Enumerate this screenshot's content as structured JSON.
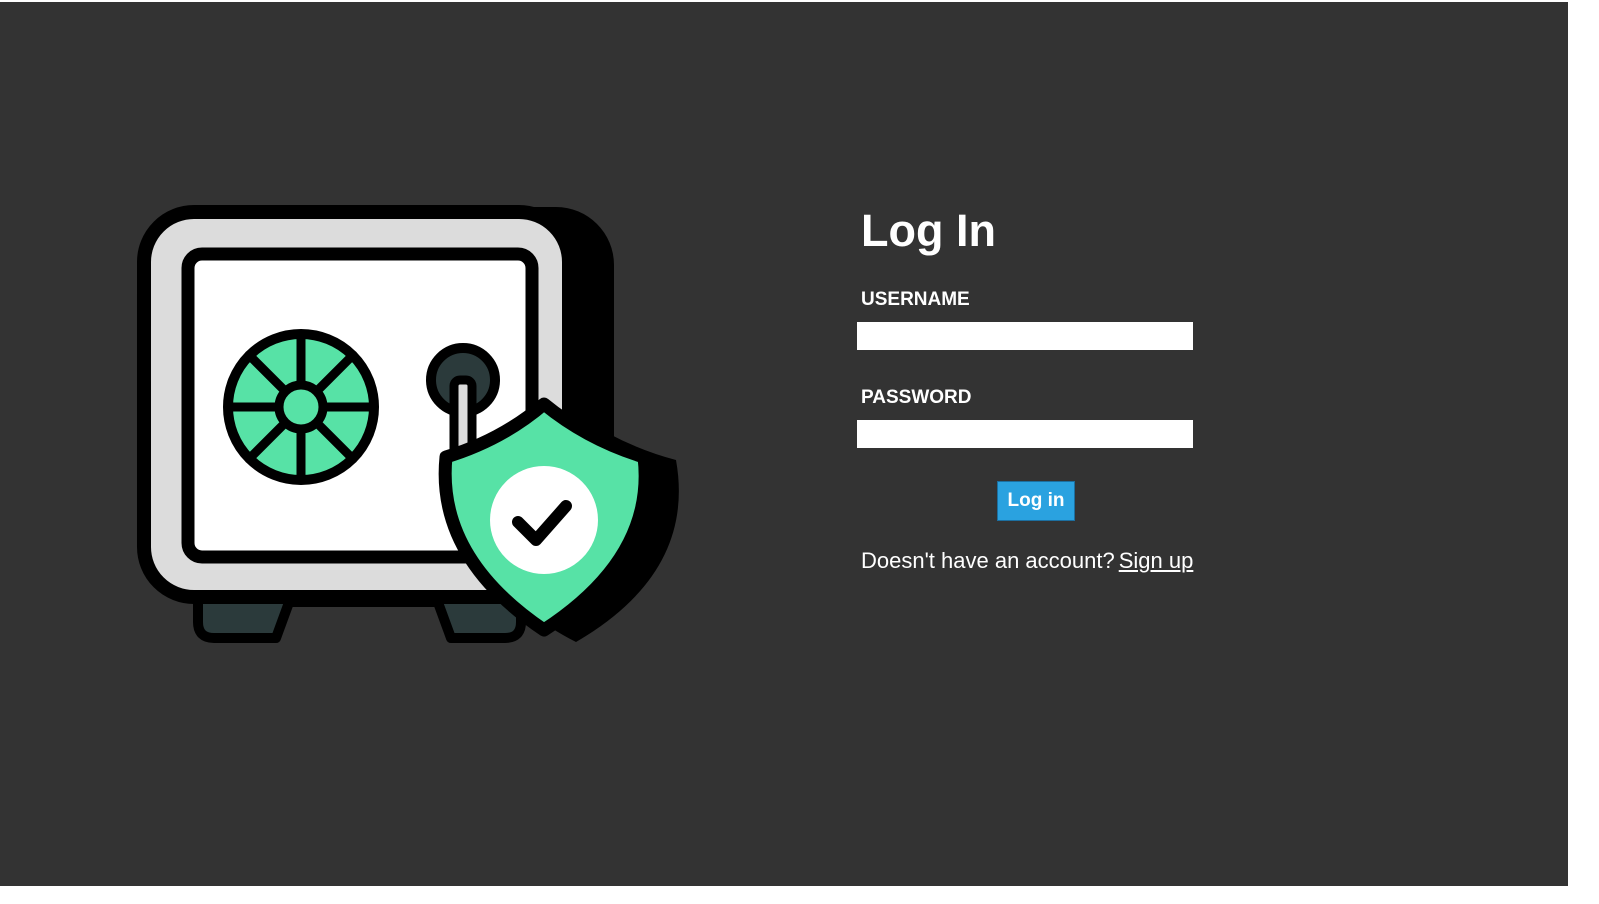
{
  "login": {
    "title": "Log In",
    "username_label": "USERNAME",
    "username_value": "",
    "password_label": "PASSWORD",
    "password_value": "",
    "submit_label": "Log in",
    "signup_prompt": "Doesn't have an account?",
    "signup_link": "Sign up"
  },
  "illustration": {
    "icon": "safe-with-shield-icon",
    "colors": {
      "accent": "#57e2a6",
      "outline": "#000000",
      "body": "#dcdcdc",
      "door": "#ffffff",
      "feet": "#2b3a3b"
    }
  },
  "colors": {
    "background": "#333333",
    "text": "#ffffff",
    "button": "#2aa2e0"
  }
}
